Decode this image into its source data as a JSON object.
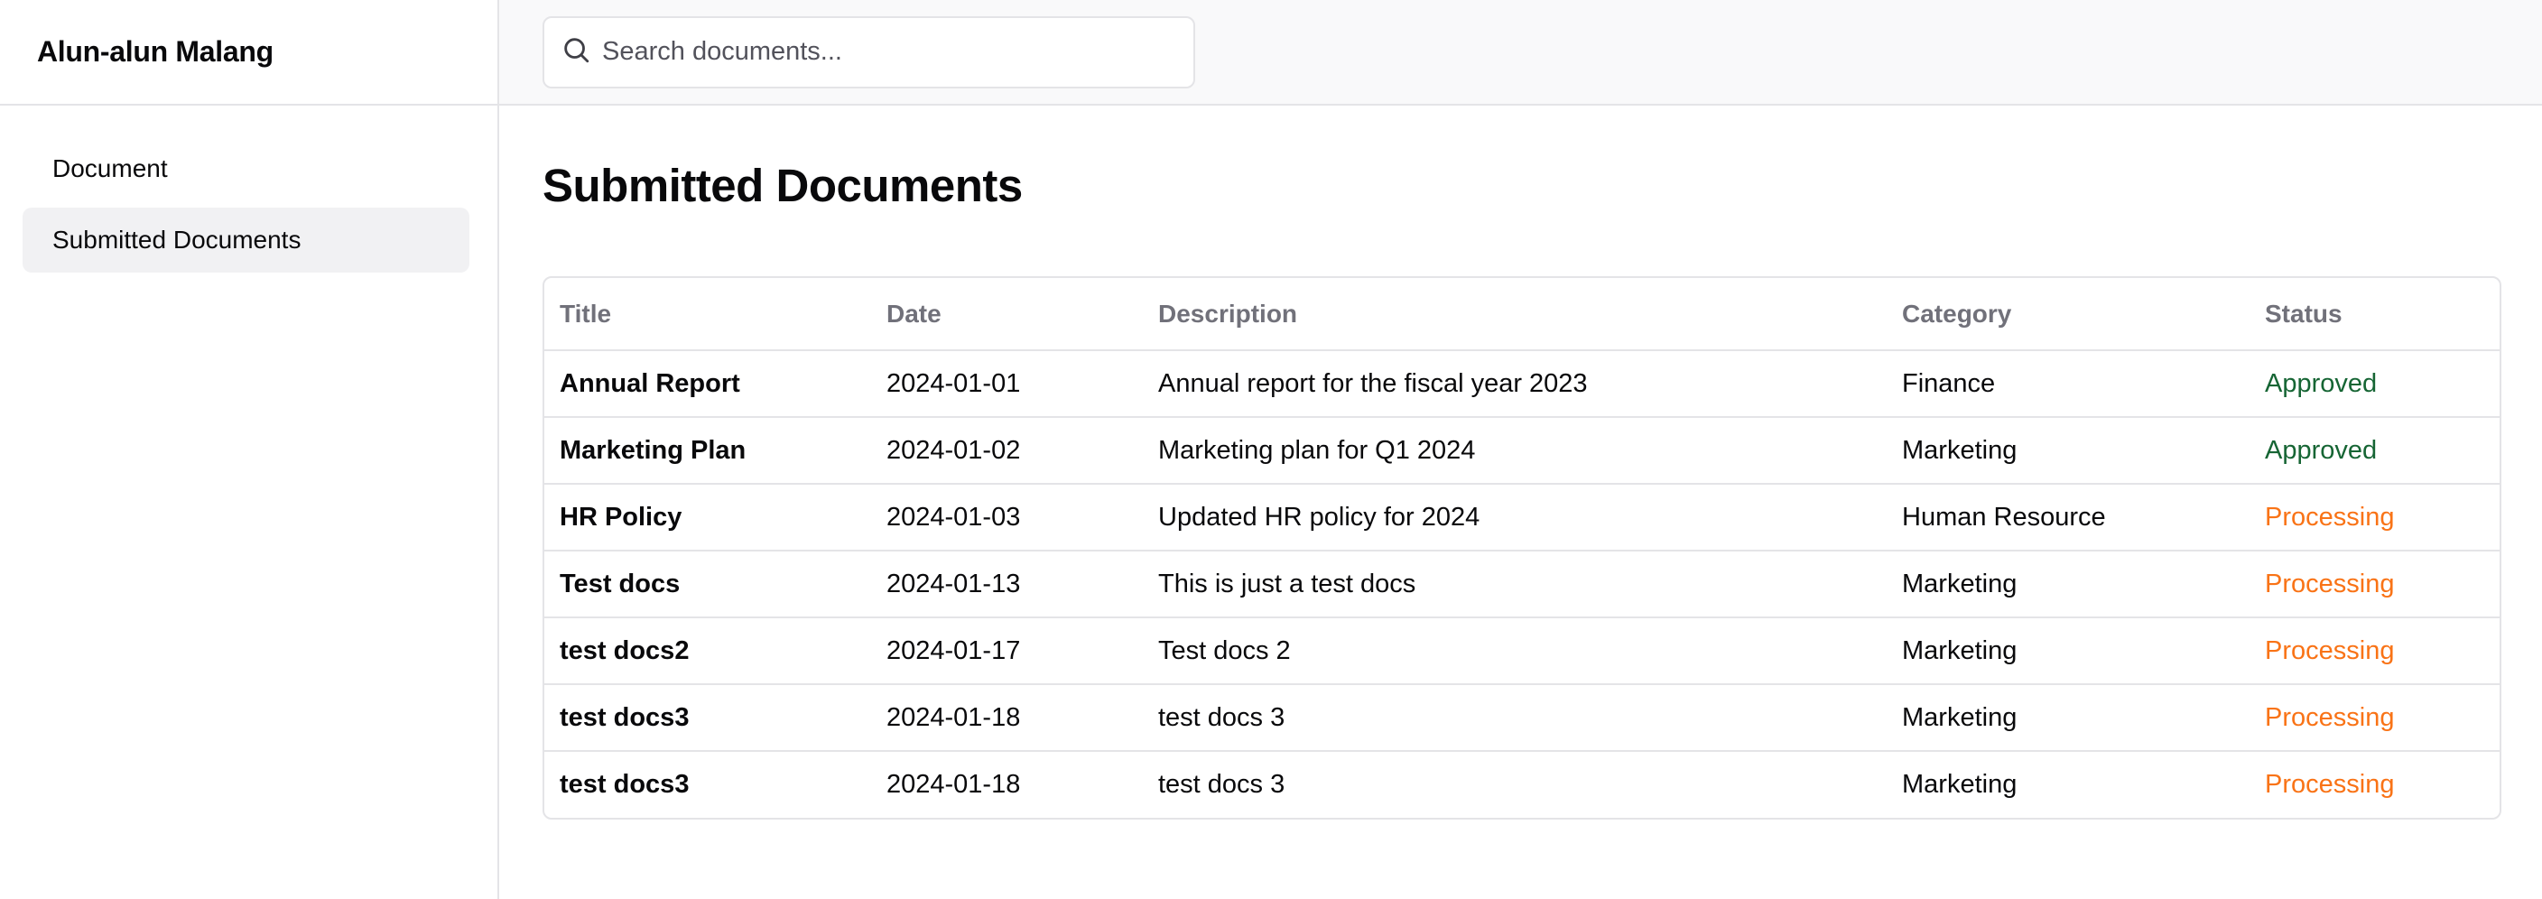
{
  "app": {
    "name": "Alun-alun Malang"
  },
  "search": {
    "placeholder": "Search documents...",
    "value": ""
  },
  "sidebar": {
    "items": [
      {
        "label": "Document",
        "active": false
      },
      {
        "label": "Submitted Documents",
        "active": true
      }
    ]
  },
  "main": {
    "title": "Submitted Documents",
    "table": {
      "headers": [
        "Title",
        "Date",
        "Description",
        "Category",
        "Status"
      ],
      "rows": [
        {
          "title": "Annual Report",
          "date": "2024-01-01",
          "description": "Annual report for the fiscal year 2023",
          "category": "Finance",
          "status": "Approved"
        },
        {
          "title": "Marketing Plan",
          "date": "2024-01-02",
          "description": "Marketing plan for Q1 2024",
          "category": "Marketing",
          "status": "Approved"
        },
        {
          "title": "HR Policy",
          "date": "2024-01-03",
          "description": "Updated HR policy for 2024",
          "category": "Human Resource",
          "status": "Processing"
        },
        {
          "title": "Test docs",
          "date": "2024-01-13",
          "description": "This is just a test docs",
          "category": "Marketing",
          "status": "Processing"
        },
        {
          "title": "test docs2",
          "date": "2024-01-17",
          "description": "Test docs 2",
          "category": "Marketing",
          "status": "Processing"
        },
        {
          "title": "test docs3",
          "date": "2024-01-18",
          "description": "test docs 3",
          "category": "Marketing",
          "status": "Processing"
        },
        {
          "title": "test docs3",
          "date": "2024-01-18",
          "description": "test docs 3",
          "category": "Marketing",
          "status": "Processing"
        }
      ]
    }
  },
  "colors": {
    "approved": "#166534",
    "processing": "#f97316",
    "border": "#e4e4e7",
    "active_nav_bg": "#f1f1f3",
    "header_text": "#71717a"
  },
  "icons": {
    "search": "search-icon"
  }
}
